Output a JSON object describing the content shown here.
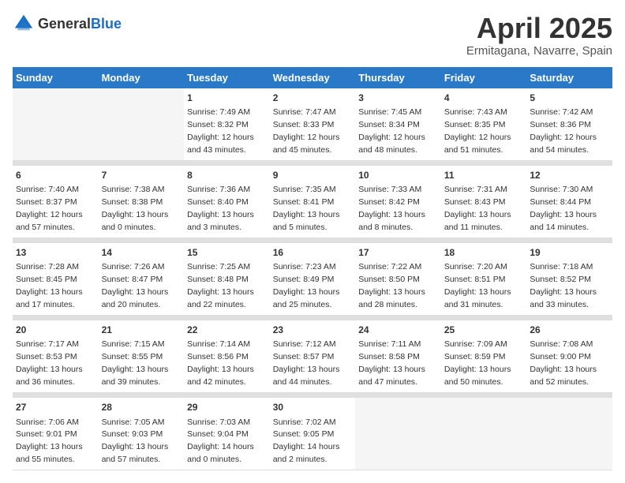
{
  "header": {
    "logo_general": "General",
    "logo_blue": "Blue",
    "month": "April 2025",
    "location": "Ermitagana, Navarre, Spain"
  },
  "days_of_week": [
    "Sunday",
    "Monday",
    "Tuesday",
    "Wednesday",
    "Thursday",
    "Friday",
    "Saturday"
  ],
  "weeks": [
    [
      {
        "day": "",
        "sunrise": "",
        "sunset": "",
        "daylight": ""
      },
      {
        "day": "",
        "sunrise": "",
        "sunset": "",
        "daylight": ""
      },
      {
        "day": "1",
        "sunrise": "Sunrise: 7:49 AM",
        "sunset": "Sunset: 8:32 PM",
        "daylight": "Daylight: 12 hours and 43 minutes."
      },
      {
        "day": "2",
        "sunrise": "Sunrise: 7:47 AM",
        "sunset": "Sunset: 8:33 PM",
        "daylight": "Daylight: 12 hours and 45 minutes."
      },
      {
        "day": "3",
        "sunrise": "Sunrise: 7:45 AM",
        "sunset": "Sunset: 8:34 PM",
        "daylight": "Daylight: 12 hours and 48 minutes."
      },
      {
        "day": "4",
        "sunrise": "Sunrise: 7:43 AM",
        "sunset": "Sunset: 8:35 PM",
        "daylight": "Daylight: 12 hours and 51 minutes."
      },
      {
        "day": "5",
        "sunrise": "Sunrise: 7:42 AM",
        "sunset": "Sunset: 8:36 PM",
        "daylight": "Daylight: 12 hours and 54 minutes."
      }
    ],
    [
      {
        "day": "6",
        "sunrise": "Sunrise: 7:40 AM",
        "sunset": "Sunset: 8:37 PM",
        "daylight": "Daylight: 12 hours and 57 minutes."
      },
      {
        "day": "7",
        "sunrise": "Sunrise: 7:38 AM",
        "sunset": "Sunset: 8:38 PM",
        "daylight": "Daylight: 13 hours and 0 minutes."
      },
      {
        "day": "8",
        "sunrise": "Sunrise: 7:36 AM",
        "sunset": "Sunset: 8:40 PM",
        "daylight": "Daylight: 13 hours and 3 minutes."
      },
      {
        "day": "9",
        "sunrise": "Sunrise: 7:35 AM",
        "sunset": "Sunset: 8:41 PM",
        "daylight": "Daylight: 13 hours and 5 minutes."
      },
      {
        "day": "10",
        "sunrise": "Sunrise: 7:33 AM",
        "sunset": "Sunset: 8:42 PM",
        "daylight": "Daylight: 13 hours and 8 minutes."
      },
      {
        "day": "11",
        "sunrise": "Sunrise: 7:31 AM",
        "sunset": "Sunset: 8:43 PM",
        "daylight": "Daylight: 13 hours and 11 minutes."
      },
      {
        "day": "12",
        "sunrise": "Sunrise: 7:30 AM",
        "sunset": "Sunset: 8:44 PM",
        "daylight": "Daylight: 13 hours and 14 minutes."
      }
    ],
    [
      {
        "day": "13",
        "sunrise": "Sunrise: 7:28 AM",
        "sunset": "Sunset: 8:45 PM",
        "daylight": "Daylight: 13 hours and 17 minutes."
      },
      {
        "day": "14",
        "sunrise": "Sunrise: 7:26 AM",
        "sunset": "Sunset: 8:47 PM",
        "daylight": "Daylight: 13 hours and 20 minutes."
      },
      {
        "day": "15",
        "sunrise": "Sunrise: 7:25 AM",
        "sunset": "Sunset: 8:48 PM",
        "daylight": "Daylight: 13 hours and 22 minutes."
      },
      {
        "day": "16",
        "sunrise": "Sunrise: 7:23 AM",
        "sunset": "Sunset: 8:49 PM",
        "daylight": "Daylight: 13 hours and 25 minutes."
      },
      {
        "day": "17",
        "sunrise": "Sunrise: 7:22 AM",
        "sunset": "Sunset: 8:50 PM",
        "daylight": "Daylight: 13 hours and 28 minutes."
      },
      {
        "day": "18",
        "sunrise": "Sunrise: 7:20 AM",
        "sunset": "Sunset: 8:51 PM",
        "daylight": "Daylight: 13 hours and 31 minutes."
      },
      {
        "day": "19",
        "sunrise": "Sunrise: 7:18 AM",
        "sunset": "Sunset: 8:52 PM",
        "daylight": "Daylight: 13 hours and 33 minutes."
      }
    ],
    [
      {
        "day": "20",
        "sunrise": "Sunrise: 7:17 AM",
        "sunset": "Sunset: 8:53 PM",
        "daylight": "Daylight: 13 hours and 36 minutes."
      },
      {
        "day": "21",
        "sunrise": "Sunrise: 7:15 AM",
        "sunset": "Sunset: 8:55 PM",
        "daylight": "Daylight: 13 hours and 39 minutes."
      },
      {
        "day": "22",
        "sunrise": "Sunrise: 7:14 AM",
        "sunset": "Sunset: 8:56 PM",
        "daylight": "Daylight: 13 hours and 42 minutes."
      },
      {
        "day": "23",
        "sunrise": "Sunrise: 7:12 AM",
        "sunset": "Sunset: 8:57 PM",
        "daylight": "Daylight: 13 hours and 44 minutes."
      },
      {
        "day": "24",
        "sunrise": "Sunrise: 7:11 AM",
        "sunset": "Sunset: 8:58 PM",
        "daylight": "Daylight: 13 hours and 47 minutes."
      },
      {
        "day": "25",
        "sunrise": "Sunrise: 7:09 AM",
        "sunset": "Sunset: 8:59 PM",
        "daylight": "Daylight: 13 hours and 50 minutes."
      },
      {
        "day": "26",
        "sunrise": "Sunrise: 7:08 AM",
        "sunset": "Sunset: 9:00 PM",
        "daylight": "Daylight: 13 hours and 52 minutes."
      }
    ],
    [
      {
        "day": "27",
        "sunrise": "Sunrise: 7:06 AM",
        "sunset": "Sunset: 9:01 PM",
        "daylight": "Daylight: 13 hours and 55 minutes."
      },
      {
        "day": "28",
        "sunrise": "Sunrise: 7:05 AM",
        "sunset": "Sunset: 9:03 PM",
        "daylight": "Daylight: 13 hours and 57 minutes."
      },
      {
        "day": "29",
        "sunrise": "Sunrise: 7:03 AM",
        "sunset": "Sunset: 9:04 PM",
        "daylight": "Daylight: 14 hours and 0 minutes."
      },
      {
        "day": "30",
        "sunrise": "Sunrise: 7:02 AM",
        "sunset": "Sunset: 9:05 PM",
        "daylight": "Daylight: 14 hours and 2 minutes."
      },
      {
        "day": "",
        "sunrise": "",
        "sunset": "",
        "daylight": ""
      },
      {
        "day": "",
        "sunrise": "",
        "sunset": "",
        "daylight": ""
      },
      {
        "day": "",
        "sunrise": "",
        "sunset": "",
        "daylight": ""
      }
    ]
  ]
}
